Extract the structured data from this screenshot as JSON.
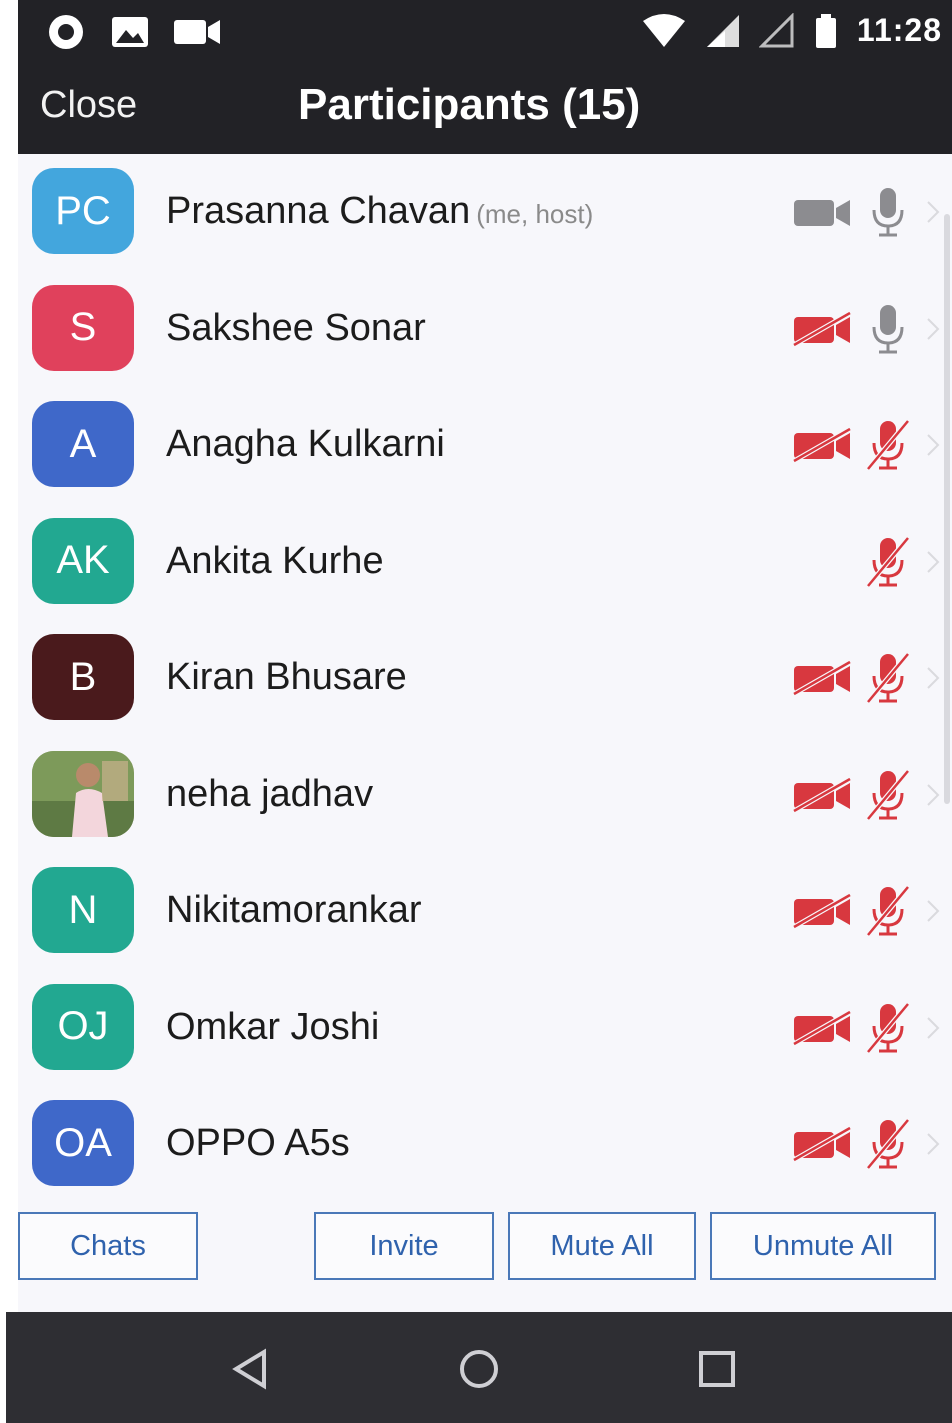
{
  "status_bar": {
    "time": "11:28"
  },
  "header": {
    "close_label": "Close",
    "title": "Participants (15)"
  },
  "participants": [
    {
      "initials": "PC",
      "name": "Prasanna Chavan",
      "tag": "(me, host)",
      "color": "#43a6dd",
      "video": "on",
      "audio": "on"
    },
    {
      "initials": "S",
      "name": "Sakshee Sonar",
      "tag": "",
      "color": "#e0415c",
      "video": "off",
      "audio": "on"
    },
    {
      "initials": "A",
      "name": "Anagha Kulkarni",
      "tag": "",
      "color": "#3f68c9",
      "video": "off",
      "audio": "off"
    },
    {
      "initials": "AK",
      "name": "Ankita Kurhe",
      "tag": "",
      "color": "#22a891",
      "video": "none",
      "audio": "off"
    },
    {
      "initials": "B",
      "name": "Kiran Bhusare",
      "tag": "",
      "color": "#4a1a1c",
      "video": "off",
      "audio": "off"
    },
    {
      "initials": "",
      "name": "neha jadhav",
      "tag": "",
      "color": "#8aa26a",
      "video": "off",
      "audio": "off",
      "photo": true
    },
    {
      "initials": "N",
      "name": "Nikitamorankar",
      "tag": "",
      "color": "#22a891",
      "video": "off",
      "audio": "off"
    },
    {
      "initials": "OJ",
      "name": "Omkar Joshi",
      "tag": "",
      "color": "#22a891",
      "video": "off",
      "audio": "off"
    },
    {
      "initials": "OA",
      "name": "OPPO A5s",
      "tag": "",
      "color": "#3f68c9",
      "video": "off",
      "audio": "off"
    }
  ],
  "actions": {
    "chats": "Chats",
    "invite": "Invite",
    "mute_all": "Mute All",
    "unmute_all": "Unmute All"
  },
  "icons": {
    "muted_color": "#d8383f",
    "active_color": "#8c8c90"
  }
}
